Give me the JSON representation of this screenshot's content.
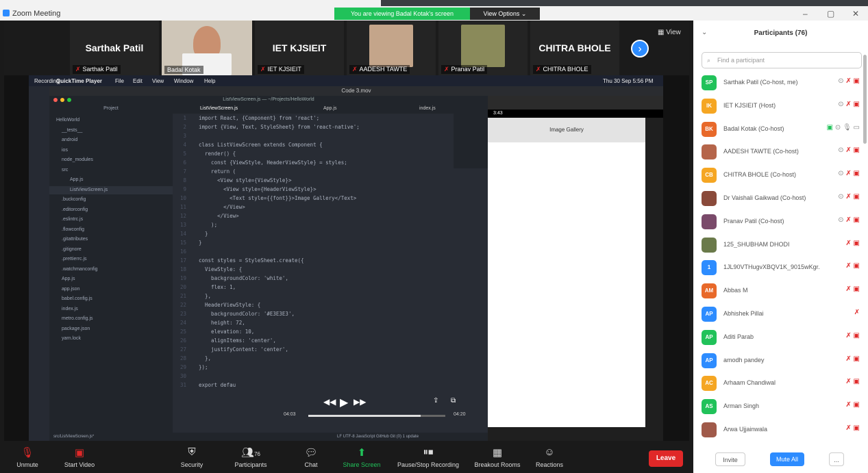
{
  "window": {
    "title": "Zoom Meeting",
    "minimize": "–",
    "restore": "▢",
    "close": "✕"
  },
  "share_banner": {
    "text": "You are viewing Badal Kotak's screen",
    "view_options": "View Options ⌄"
  },
  "gallery": {
    "tiles": [
      {
        "big_name": "Sarthak Patil",
        "tag": "Sarthak Patil"
      },
      {
        "big_name": "",
        "tag": "Badal Kotak"
      },
      {
        "big_name": "IET KJSIEIT",
        "tag": "IET KJSIEIT"
      },
      {
        "big_name": "",
        "tag": "AADESH TAWTE"
      },
      {
        "big_name": "",
        "tag": "Pranav Patil"
      },
      {
        "big_name": "CHITRA BHOLE",
        "tag": "CHITRA BHOLE"
      }
    ],
    "view_label": "View",
    "next_icon": "chevron-right"
  },
  "shared_screen": {
    "menubar": {
      "app": "QuickTime Player",
      "items": [
        "File",
        "Edit",
        "View",
        "Window",
        "Help"
      ],
      "clock": "Thu 30 Sep 5:56 PM",
      "recording": "Recording..."
    },
    "qt_title": "Code 3.mov",
    "editor_title": "ListViewScreen.js — ~/Projects/HelloWorld",
    "tree_header": "Project",
    "tree": [
      "HelloWorld",
      "__tests__",
      "android",
      "ios",
      "node_modules",
      "src",
      "App.js",
      "ListViewScreen.js",
      ".buckconfig",
      ".editorconfig",
      ".eslintrc.js",
      ".flowconfig",
      ".gitattributes",
      ".gitignore",
      ".prettierrc.js",
      ".watchmanconfig",
      "App.js",
      "app.json",
      "babel.config.js",
      "index.js",
      "metro.config.js",
      "package.json",
      "yarn.lock"
    ],
    "tabs": [
      "ListViewScreen.js",
      "App.js",
      "index.js"
    ],
    "code_lines": [
      "import React, {Component} from 'react';",
      "import {View, Text, StyleSheet} from 'react-native';",
      "",
      "class ListViewScreen extends Component {",
      "  render() {",
      "    const {ViewStyle, HeaderViewStyle} = styles;",
      "    return (",
      "      <View style={ViewStyle}>",
      "        <View style={HeaderViewStyle}>",
      "          <Text style={{font}}>Image Gallery</Text>",
      "        </View>",
      "      </View>",
      "    );",
      "  }",
      "}",
      "",
      "const styles = StyleSheet.create({",
      "  ViewStyle: {",
      "    backgroundColor: 'white',",
      "    flex: 1,",
      "  },",
      "  HeaderViewStyle: {",
      "    backgroundColor: '#E3E3E3',",
      "    height: 72,",
      "    elevation: 10,",
      "    alignItems: 'center',",
      "    justifyContent: 'center',",
      "  },",
      "});",
      "",
      "export defau"
    ],
    "statusbar": {
      "left": "src/ListViewScreen.js*",
      "right": "LF  UTF-8  JavaScript  GitHub  Git (0)  1 update"
    },
    "player": {
      "elapsed": "04:03",
      "remaining": "04:20",
      "progress": 0.82
    },
    "emulator": {
      "status_time": "3:43",
      "header_text": "Image Gallery"
    }
  },
  "toolbar": {
    "buttons": [
      {
        "label": "Unmute",
        "icon": "mic-off"
      },
      {
        "label": "Start Video",
        "icon": "video-off"
      },
      {
        "label": "Security",
        "icon": "shield"
      },
      {
        "label": "Participants",
        "icon": "people",
        "count": "76"
      },
      {
        "label": "Chat",
        "icon": "chat"
      },
      {
        "label": "Share Screen",
        "icon": "share"
      },
      {
        "label": "Pause/Stop Recording",
        "icon": "pause"
      },
      {
        "label": "Breakout Rooms",
        "icon": "grid"
      },
      {
        "label": "Reactions",
        "icon": "smile"
      }
    ],
    "leave": "Leave"
  },
  "panel": {
    "title": "Participants (76)",
    "search_placeholder": "Find a participant",
    "participants": [
      {
        "initials": "SP",
        "name": "Sarthak Patil (Co-host, me)",
        "color": "#21c25a"
      },
      {
        "initials": "IK",
        "name": "IET KJSIEIT (Host)",
        "color": "#f5a623"
      },
      {
        "initials": "BK",
        "name": "Badal Kotak (Co-host)",
        "color": "#e8692a"
      },
      {
        "initials": "",
        "name": "AADESH TAWTE (Co-host)",
        "color": "#b5654a"
      },
      {
        "initials": "CB",
        "name": "CHITRA BHOLE (Co-host)",
        "color": "#f5a623"
      },
      {
        "initials": "",
        "name": "Dr Vaishali Gaikwad (Co-host)",
        "color": "#8a4a3a"
      },
      {
        "initials": "",
        "name": "Pranav Patil (Co-host)",
        "color": "#7a4a6a"
      },
      {
        "initials": "",
        "name": "125_SHUBHAM DHODI",
        "color": "#6a7a4a"
      },
      {
        "initials": "1",
        "name": "1JL90VTHugvXBQV1K_9015wKgr...",
        "color": "#2d8cff"
      },
      {
        "initials": "AM",
        "name": "Abbas M",
        "color": "#e8692a"
      },
      {
        "initials": "AP",
        "name": "Abhishek Pillai",
        "color": "#2d8cff"
      },
      {
        "initials": "AP",
        "name": "Aditi Parab",
        "color": "#21c25a"
      },
      {
        "initials": "AP",
        "name": "amodh pandey",
        "color": "#2d8cff"
      },
      {
        "initials": "AC",
        "name": "Arhaam Chandiwal",
        "color": "#f5a623"
      },
      {
        "initials": "AS",
        "name": "Arman Singh",
        "color": "#21c25a"
      },
      {
        "initials": "",
        "name": "Arwa Ujjainwala",
        "color": "#a05a4a"
      }
    ],
    "invite": "Invite",
    "mute_all": "Mute All",
    "more": "..."
  }
}
